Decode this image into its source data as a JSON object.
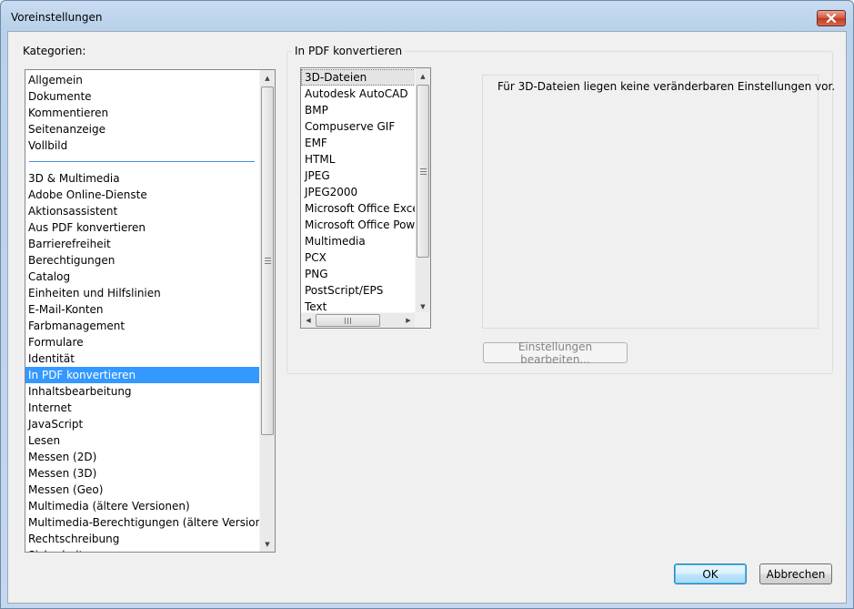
{
  "window": {
    "title": "Voreinstellungen",
    "close_icon": "close-icon"
  },
  "categories": {
    "label": "Kategorien:",
    "items_top": [
      "Allgemein",
      "Dokumente",
      "Kommentieren",
      "Seitenanzeige",
      "Vollbild"
    ],
    "items_bottom": [
      "3D & Multimedia",
      "Adobe Online-Dienste",
      "Aktionsassistent",
      "Aus PDF konvertieren",
      "Barrierefreiheit",
      "Berechtigungen",
      "Catalog",
      "Einheiten und Hilfslinien",
      "E-Mail-Konten",
      "Farbmanagement",
      "Formulare",
      "Identität",
      "In PDF konvertieren",
      "Inhaltsbearbeitung",
      "Internet",
      "JavaScript",
      "Lesen",
      "Messen (2D)",
      "Messen (3D)",
      "Messen (Geo)",
      "Multimedia (ältere Versionen)",
      "Multimedia-Berechtigungen (ältere Versionen)",
      "Rechtschreibung",
      "Sicherheit"
    ],
    "selected": "In PDF konvertieren"
  },
  "convert": {
    "group_label": "In PDF konvertieren",
    "formats": [
      "3D-Dateien",
      "Autodesk AutoCAD",
      "BMP",
      "Compuserve GIF",
      "EMF",
      "HTML",
      "JPEG",
      "JPEG2000",
      "Microsoft Office Excel",
      "Microsoft Office PowerPoint",
      "Multimedia",
      "PCX",
      "PNG",
      "PostScript/EPS",
      "Text"
    ],
    "selected": "3D-Dateien",
    "info_text": "Für 3D-Dateien liegen keine veränderbaren Einstellungen vor.",
    "edit_button": "Einstellungen bearbeiten..."
  },
  "footer": {
    "ok_label": "OK",
    "cancel_label": "Abbrechen"
  }
}
